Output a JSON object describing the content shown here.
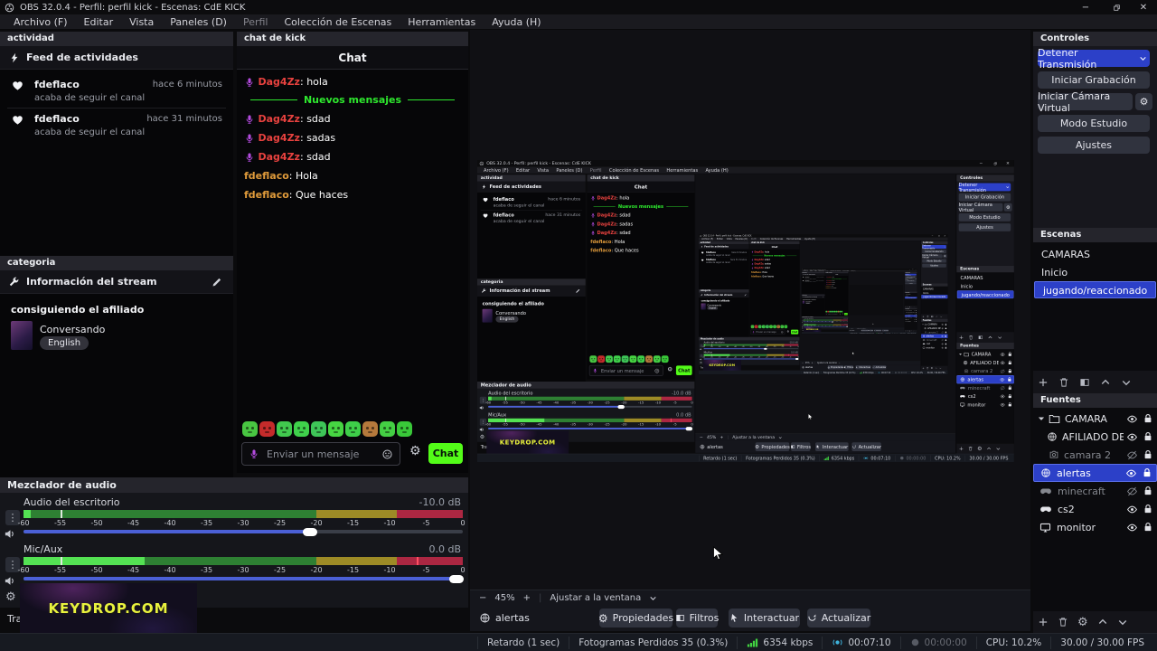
{
  "window": {
    "title": "OBS 32.0.4 - Perfil: perfil kick - Escenas: CdE KICK"
  },
  "menu": [
    "Archivo (F)",
    "Editar",
    "Vista",
    "Paneles (D)",
    "Perfil",
    "Colección de Escenas",
    "Herramientas",
    "Ayuda (H)"
  ],
  "activity": {
    "dock_title": "actividad",
    "header": "Feed de actividades",
    "events": [
      {
        "user": "fdeflaco",
        "action": "acaba de seguir el canal",
        "time": "hace 6 minutos"
      },
      {
        "user": "fdeflaco",
        "action": "acaba de seguir el canal",
        "time": "hace 31 minutos"
      }
    ]
  },
  "category": {
    "dock_title": "categoria",
    "header": "Información del stream",
    "stream_title": "consiguiendo el afiliado",
    "category_name": "Conversando",
    "language": "English"
  },
  "chat": {
    "dock_title": "chat de kick",
    "title": "Chat",
    "colon": ":",
    "divider": "Nuevos mensajes",
    "messages": [
      {
        "user": "Dag4Zz",
        "text": "hola",
        "color": "#e8423f",
        "badge": true
      },
      {
        "user": "Dag4Zz",
        "text": "sdad",
        "color": "#e8423f",
        "badge": true
      },
      {
        "user": "Dag4Zz",
        "text": "sadas",
        "color": "#e8423f",
        "badge": true
      },
      {
        "user": "Dag4Zz",
        "text": "sdad",
        "color": "#e8423f",
        "badge": true
      },
      {
        "user": "fdeflaco",
        "text": "Hola",
        "color": "#e09b3b",
        "badge": false
      },
      {
        "user": "fdeflaco",
        "text": "Que haces",
        "color": "#e09b3b",
        "badge": false
      }
    ],
    "emotes": [
      {
        "name": "halo-blob",
        "color": "#49c642"
      },
      {
        "name": "angry-red",
        "color": "#c42b2b"
      },
      {
        "name": "masked-blob",
        "color": "#41c94e"
      },
      {
        "name": "grin-blob",
        "color": "#3fd14b"
      },
      {
        "name": "hood-blob",
        "color": "#3ec558"
      },
      {
        "name": "smile-blob",
        "color": "#46d542"
      },
      {
        "name": "tall-blob",
        "color": "#3ecf49"
      },
      {
        "name": "monkey",
        "color": "#b5793c"
      },
      {
        "name": "wink-blob",
        "color": "#44cf44"
      },
      {
        "name": "hearteyes-blob",
        "color": "#39c839"
      }
    ],
    "input_placeholder": "Enviar un mensaje",
    "send_button": "Chat"
  },
  "mixer": {
    "dock_title": "Mezclador de audio",
    "tick_labels": [
      "-60",
      "-55",
      "-50",
      "-45",
      "-40",
      "-35",
      "-30",
      "-25",
      "-20",
      "-15",
      "-10",
      "-5",
      "0"
    ],
    "channels": [
      {
        "label": "Audio del escritorio",
        "value": "-10.0 dB",
        "meter_db": -59,
        "peak_db": -55,
        "slider": 0.652
      },
      {
        "label": "Mic/Aux",
        "value": "0.0 dB",
        "meter_db": -43.5,
        "peak_db": -55,
        "clip_db": -6.3,
        "slider": 0.985
      }
    ],
    "partial_dock_label": "Tra"
  },
  "preview": {
    "zoom_out": "−",
    "zoom": "45%",
    "zoom_in": "+",
    "fit": "Ajustar a la ventana",
    "scale": 0.464
  },
  "source_bar": {
    "source": "alertas",
    "properties": "Propiedades",
    "filters": "Filtros",
    "interact": "Interactuar",
    "refresh": "Actualizar"
  },
  "controls": {
    "dock_title": "Controles",
    "stop_stream": "Detener Transmisión",
    "start_rec": "Iniciar Grabación",
    "start_vcam": "Iniciar Cámara Virtual",
    "studio_mode": "Modo Estudio",
    "settings": "Ajustes"
  },
  "scenes": {
    "dock_title": "Escenas",
    "items": [
      "CAMARAS",
      "Inicio",
      "jugando/reaccionado"
    ],
    "selected_index": 2
  },
  "sources": {
    "dock_title": "Fuentes",
    "items": [
      {
        "name": "CAMARA",
        "icon": "folder-group",
        "visible": true,
        "locked": true
      },
      {
        "name": "AFILIADO DE KEYI",
        "icon": "browser-globe",
        "visible": true,
        "locked": true
      },
      {
        "name": "camara 2",
        "icon": "camera",
        "visible": false,
        "locked": true
      },
      {
        "name": "alertas",
        "icon": "browser-globe",
        "visible": true,
        "locked": true,
        "selected": true
      },
      {
        "name": "minecraft",
        "icon": "game-capture",
        "visible": false,
        "locked": true
      },
      {
        "name": "cs2",
        "icon": "game-capture",
        "visible": true,
        "locked": true
      },
      {
        "name": "monitor",
        "icon": "display-capture",
        "visible": true,
        "locked": true
      }
    ]
  },
  "status": {
    "delay": "Retardo (1 sec)",
    "dropped": "Fotogramas Perdidos 35 (0.3%)",
    "bitrate": "6354 kbps",
    "stream_time": "00:07:10",
    "rec_time": "00:00:00",
    "cpu": "CPU: 10.2%",
    "fps": "30.00 / 30.00 FPS"
  },
  "overlay": {
    "text": "KEYDROP.COM"
  }
}
